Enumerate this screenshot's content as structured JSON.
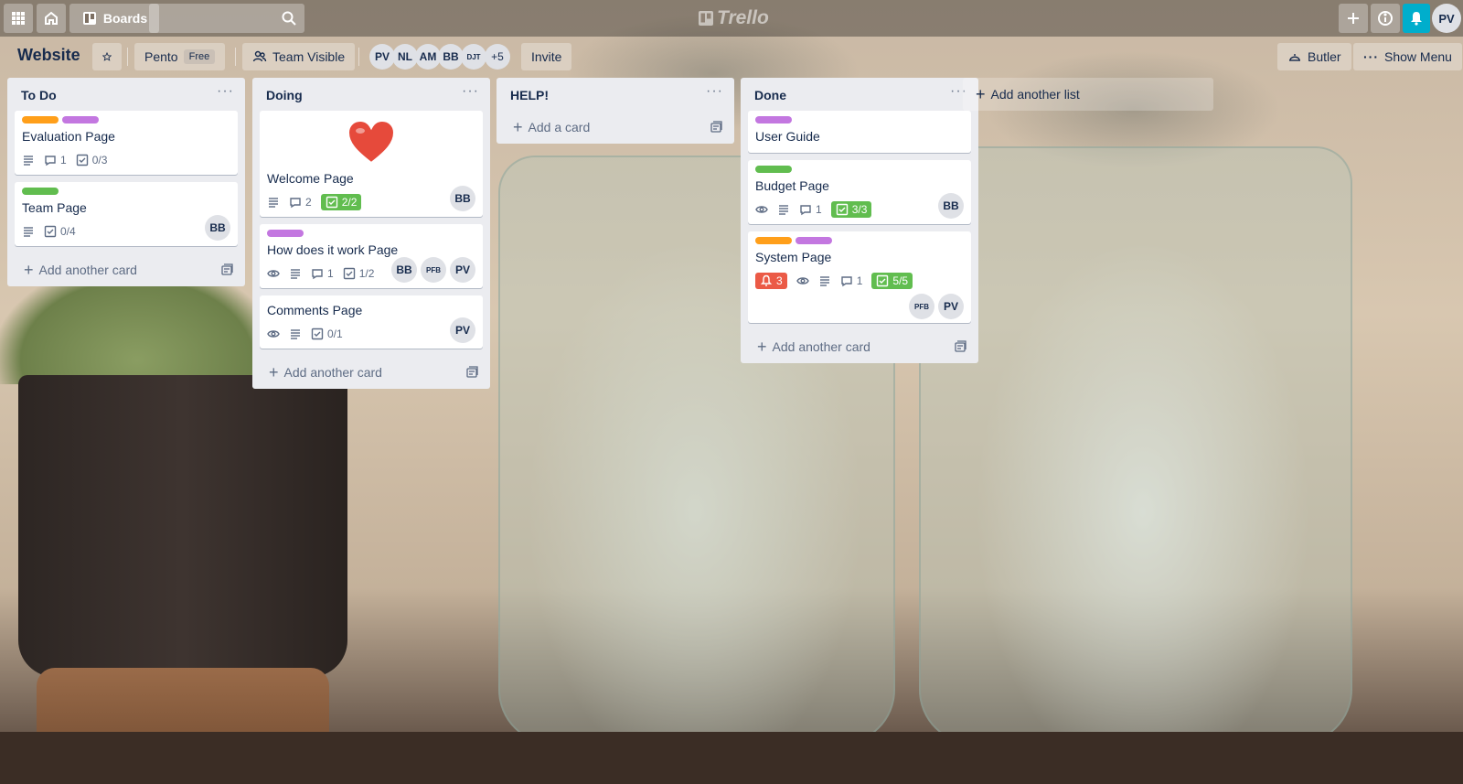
{
  "topbar": {
    "boards_label": "Boards",
    "logo_text": "Trello",
    "user_initials": "PV"
  },
  "board": {
    "title": "Website",
    "team": "Pento",
    "plan_badge": "Free",
    "visibility": "Team Visible",
    "members": [
      "PV",
      "NL",
      "AM",
      "BB",
      "DJT"
    ],
    "more_members": "+5",
    "invite_label": "Invite",
    "butler_label": "Butler",
    "show_menu_label": "Show Menu"
  },
  "lists": [
    {
      "title": "To Do",
      "add_label": "Add another card",
      "cards": [
        {
          "title": "Evaluation Page",
          "comments": "1",
          "checklist": "0/3"
        },
        {
          "title": "Team Page",
          "checklist": "0/4",
          "members": [
            "BB"
          ]
        }
      ]
    },
    {
      "title": "Doing",
      "add_label": "Add another card",
      "cards": [
        {
          "title": "Welcome Page",
          "comments": "2",
          "checklist": "2/2",
          "members": [
            "BB"
          ]
        },
        {
          "title": "How does it work Page",
          "comments": "1",
          "checklist": "1/2",
          "members": [
            "BB",
            "PFB",
            "PV"
          ]
        },
        {
          "title": "Comments Page",
          "checklist": "0/1",
          "members": [
            "PV"
          ]
        }
      ]
    },
    {
      "title": "HELP!",
      "add_label": "Add a card",
      "cards": []
    },
    {
      "title": "Done",
      "add_label": "Add another card",
      "cards": [
        {
          "title": "User Guide"
        },
        {
          "title": "Budget Page",
          "comments": "1",
          "checklist": "3/3",
          "members": [
            "BB"
          ]
        },
        {
          "title": "System Page",
          "due": "3",
          "comments": "1",
          "checklist": "5/5",
          "members": [
            "PFB",
            "PV"
          ]
        }
      ]
    }
  ],
  "add_list_label": "Add another list",
  "colors": {
    "label_orange": "#ff9f1a",
    "label_purple": "#c377e0",
    "label_green": "#61bd4f",
    "badge_green": "#61bd4f",
    "badge_red": "#eb5a46",
    "notification_blue": "#00aecc"
  },
  "icons": [
    "apps-icon",
    "home-icon",
    "board-icon",
    "search-icon",
    "plus-icon",
    "info-icon",
    "bell-icon",
    "star-icon",
    "people-icon",
    "butler-icon",
    "eye-icon",
    "description-icon",
    "comment-icon",
    "checklist-icon",
    "template-icon",
    "heart-icon"
  ]
}
